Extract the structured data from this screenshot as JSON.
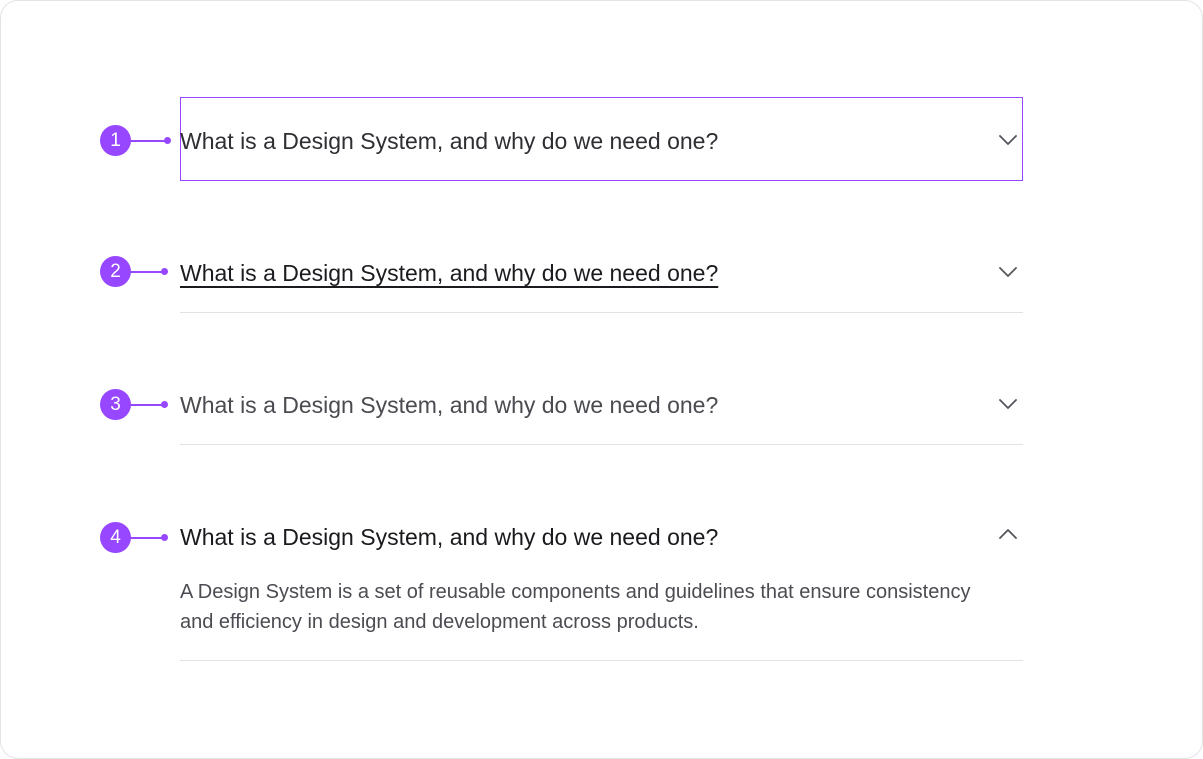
{
  "items": [
    {
      "number": "1",
      "question": "What is a Design System, and why do we need one?",
      "state": "focused",
      "chevron": "chevron-down-icon"
    },
    {
      "number": "2",
      "question": "What is a Design System, and why do we need one?",
      "state": "hover",
      "chevron": "chevron-down-icon"
    },
    {
      "number": "3",
      "question": "What is a Design System, and why do we need one?",
      "state": "default",
      "chevron": "chevron-down-icon"
    },
    {
      "number": "4",
      "question": "What is a Design System, and why do we need one?",
      "state": "expanded",
      "chevron": "chevron-up-icon",
      "answer": "A Design System is a set of reusable components and guidelines that ensure consistency and efficiency in design and development across products."
    }
  ],
  "colors": {
    "accent": "#9747ff",
    "divider": "#e2e2e5",
    "text": "#2e2e33",
    "muted_text": "#4b4b52"
  }
}
